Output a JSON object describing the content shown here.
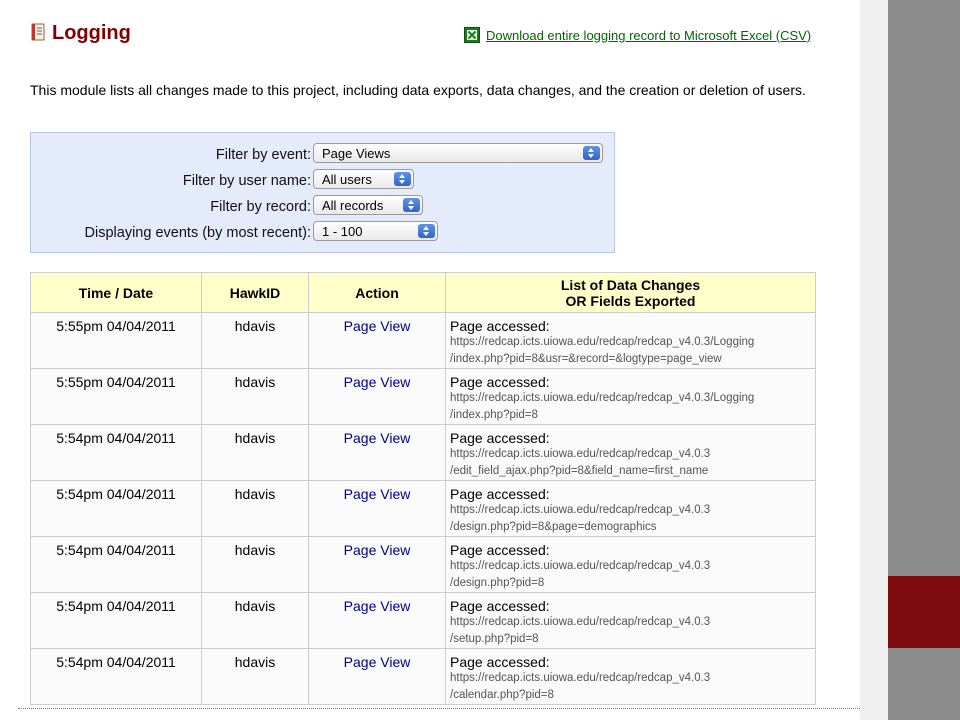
{
  "header": {
    "title": "Logging",
    "download_label": "Download entire logging record to Microsoft Excel (CSV)"
  },
  "intro": "This module lists all changes made to this project, including data exports, data changes, and the creation or deletion of users.",
  "filters": [
    {
      "label": "Filter by event:",
      "value": "Page Views"
    },
    {
      "label": "Filter by user name:",
      "value": "All users"
    },
    {
      "label": "Filter by record:",
      "value": "All records"
    },
    {
      "label": "Displaying events (by most recent):",
      "value": "1 - 100"
    }
  ],
  "table": {
    "headers": [
      "Time / Date",
      "HawkID",
      "Action",
      "List of Data Changes",
      "OR Fields Exported"
    ],
    "rows": [
      {
        "time": "5:55pm 04/04/2011",
        "user": "hdavis",
        "action": "Page View",
        "title": "Page accessed:",
        "url1": "https://redcap.icts.uiowa.edu/redcap/redcap_v4.0.3/Logging",
        "url2": "/index.php?pid=8&usr=&record=&logtype=page_view"
      },
      {
        "time": "5:55pm 04/04/2011",
        "user": "hdavis",
        "action": "Page View",
        "title": "Page accessed:",
        "url1": "https://redcap.icts.uiowa.edu/redcap/redcap_v4.0.3/Logging",
        "url2": "/index.php?pid=8"
      },
      {
        "time": "5:54pm 04/04/2011",
        "user": "hdavis",
        "action": "Page View",
        "title": "Page accessed:",
        "url1": "https://redcap.icts.uiowa.edu/redcap/redcap_v4.0.3",
        "url2": "/edit_field_ajax.php?pid=8&field_name=first_name"
      },
      {
        "time": "5:54pm 04/04/2011",
        "user": "hdavis",
        "action": "Page View",
        "title": "Page accessed:",
        "url1": "https://redcap.icts.uiowa.edu/redcap/redcap_v4.0.3",
        "url2": "/design.php?pid=8&page=demographics"
      },
      {
        "time": "5:54pm 04/04/2011",
        "user": "hdavis",
        "action": "Page View",
        "title": "Page accessed:",
        "url1": "https://redcap.icts.uiowa.edu/redcap/redcap_v4.0.3",
        "url2": "/design.php?pid=8"
      },
      {
        "time": "5:54pm 04/04/2011",
        "user": "hdavis",
        "action": "Page View",
        "title": "Page accessed:",
        "url1": "https://redcap.icts.uiowa.edu/redcap/redcap_v4.0.3",
        "url2": "/setup.php?pid=8"
      },
      {
        "time": "5:54pm 04/04/2011",
        "user": "hdavis",
        "action": "Page View",
        "title": "Page accessed:",
        "url1": "https://redcap.icts.uiowa.edu/redcap/redcap_v4.0.3",
        "url2": "/calendar.php?pid=8"
      }
    ]
  },
  "icons": {
    "logging": "notebook-icon",
    "download": "excel-icon",
    "select": "select-arrows-icon"
  },
  "colors": {
    "title": "#800000",
    "link": "#006600",
    "action": "#000080",
    "filter_bg": "#e4ebfb",
    "header_bg": "#ffffcc",
    "side_accent": "#7d0a0f"
  }
}
